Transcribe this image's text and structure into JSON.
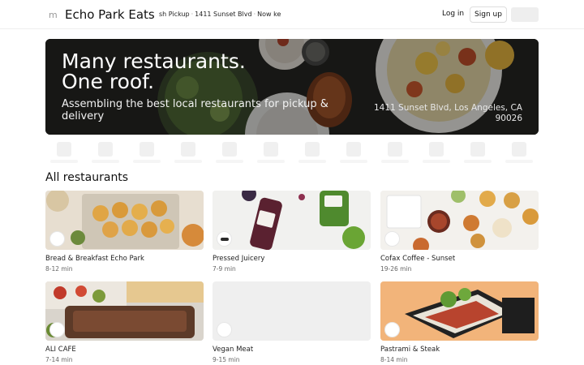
{
  "header": {
    "menu_glyph": "m",
    "brand": "Echo Park Eats",
    "fulfillment_prefix": "sh",
    "fulfillment_mode": "Pickup",
    "fulfillment_address": "1411 Sunset Blvd",
    "fulfillment_time": "Now",
    "fulfillment_suffix": "ke",
    "login_label": "Log in",
    "signup_label": "Sign up"
  },
  "hero": {
    "title_line1": "Many restaurants.",
    "title_line2": "One roof.",
    "subtitle": "Assembling the best local restaurants for pickup & delivery",
    "address": "1411 Sunset Blvd, Los Angeles, CA 90026"
  },
  "categories_placeholder_count": 12,
  "section_title": "All restaurants",
  "restaurants": [
    {
      "name": "Bread & Breakfast Echo Park",
      "time": "8-12 min"
    },
    {
      "name": "Pressed Juicery",
      "time": "7-9 min"
    },
    {
      "name": "Cofax Coffee - Sunset",
      "time": "19-26 min"
    },
    {
      "name": "ALI CAFE",
      "time": "7-14 min"
    },
    {
      "name": "Vegan Meat",
      "time": "9-15 min"
    },
    {
      "name": "Pastrami & Steak",
      "time": "8-14 min"
    }
  ],
  "icons": {
    "menu": "menu-icon",
    "cart": "cart-placeholder"
  },
  "colors": {
    "hero_overlay": "#1e1f1c",
    "placeholder": "#efefef",
    "text": "#111111"
  }
}
